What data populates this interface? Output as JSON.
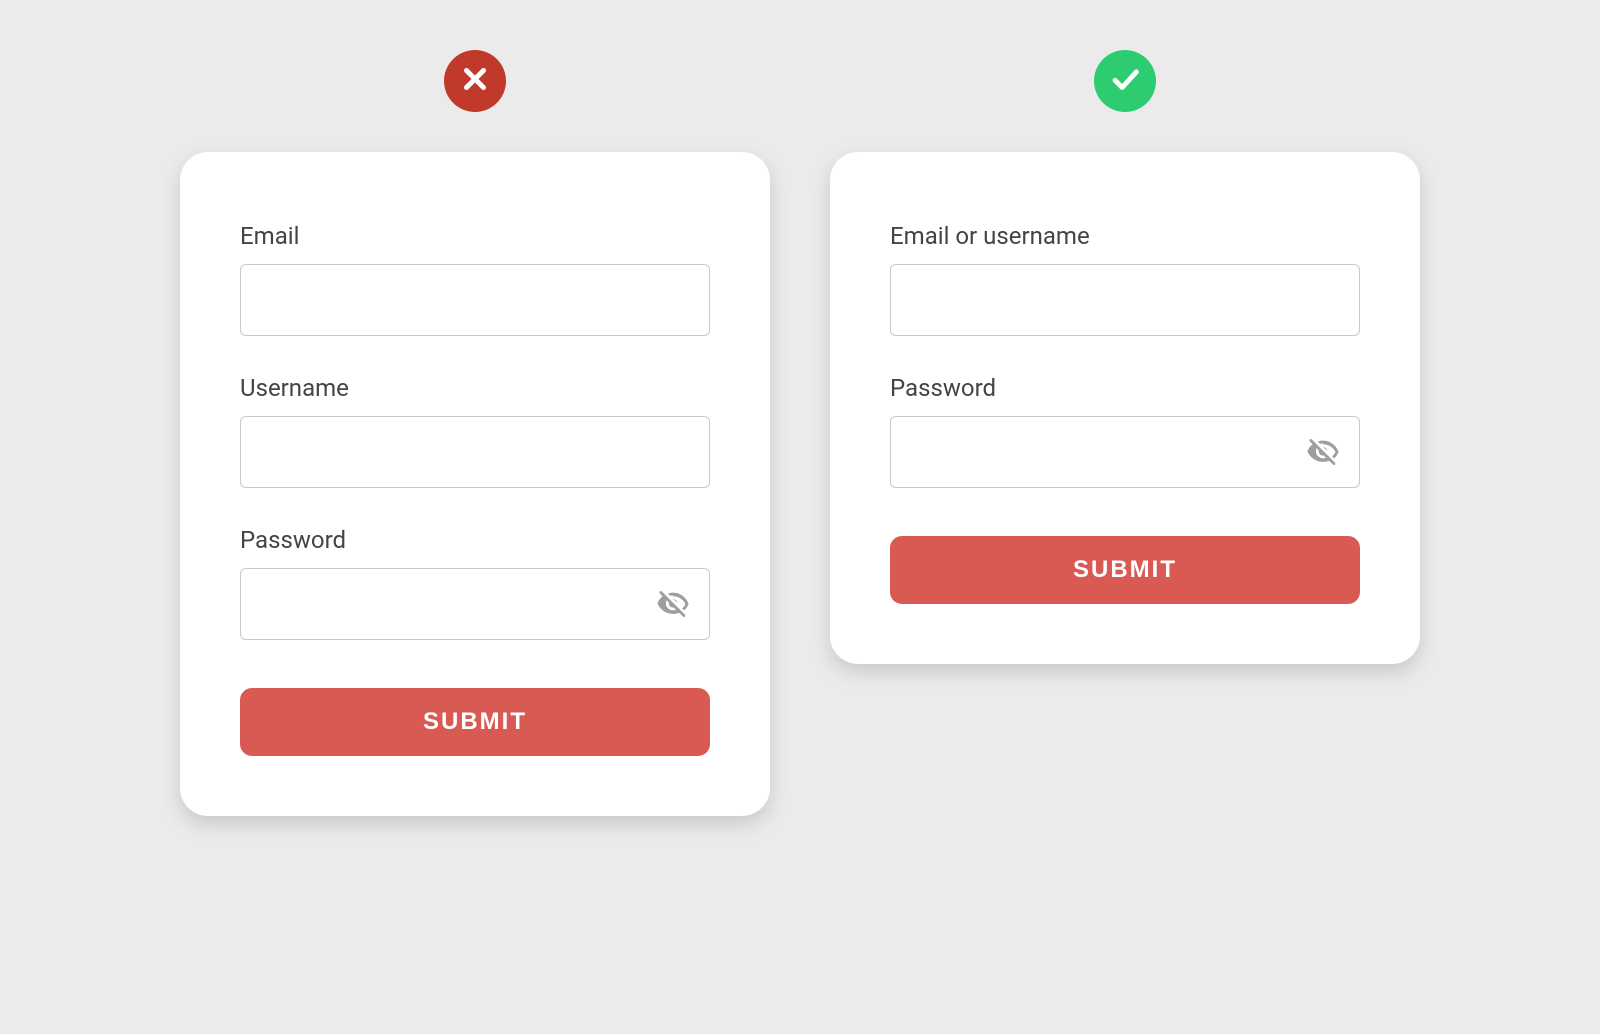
{
  "bad_example": {
    "badge_type": "incorrect",
    "fields": {
      "email": {
        "label": "Email",
        "value": ""
      },
      "username": {
        "label": "Username",
        "value": ""
      },
      "password": {
        "label": "Password",
        "value": "",
        "has_visibility_toggle": true
      }
    },
    "submit_label": "SUBMIT"
  },
  "good_example": {
    "badge_type": "correct",
    "fields": {
      "email_or_username": {
        "label": "Email or username",
        "value": ""
      },
      "password": {
        "label": "Password",
        "value": "",
        "has_visibility_toggle": true
      }
    },
    "submit_label": "SUBMIT"
  },
  "colors": {
    "card_bg": "#ffffff",
    "page_bg": "#ebebeb",
    "submit_bg": "#d95a52",
    "bad_badge": "#c0392b",
    "good_badge": "#2ecc71",
    "label_text": "#444444",
    "input_border": "#c8c8c8",
    "icon_gray": "#9e9e9e"
  }
}
